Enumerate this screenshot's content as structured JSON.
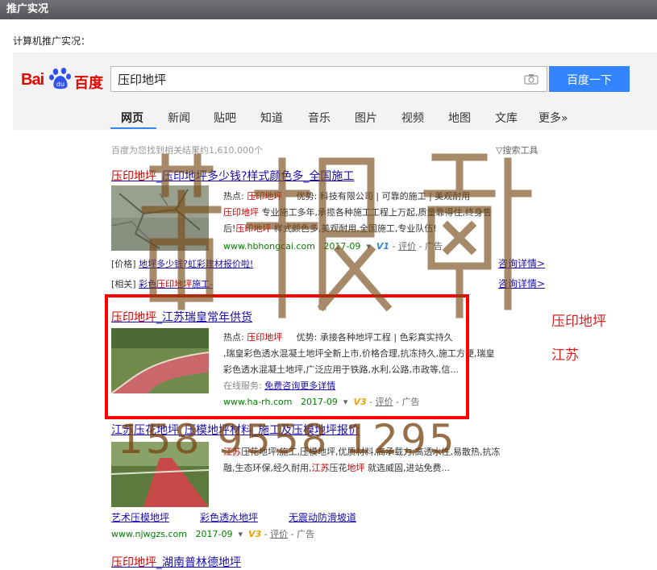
{
  "header": {
    "title": "推广实况"
  },
  "subtitle": "计算机推广实况：",
  "brand": {
    "part1": "Bai",
    "badge": "du",
    "part2": "百度"
  },
  "search": {
    "query": "压印地坪",
    "button": "百度一下"
  },
  "tabs": [
    "网页",
    "新闻",
    "贴吧",
    "知道",
    "音乐",
    "图片",
    "视频",
    "地图",
    "文库",
    "更多»"
  ],
  "stats": "百度为您找到相关结果约1,610,000个",
  "tools": "搜索工具",
  "results": [
    {
      "title_highlight": "压印地坪",
      "title_rest": "_压印地坪多少钱?样式颜色多_全国施工",
      "desc_line1_label": "热点: ",
      "desc_line1_kw": "压印地坪",
      "desc_line1_rest": "     优势: 科技有限公司 | 可靠的施工 | 美观耐用",
      "desc_line2_kw": "压印地坪",
      "desc_line2_rest": " 专业施工多年,承揽各种施工工程上万起,质量靠得住,终身售",
      "desc_line3_pre": "后!",
      "desc_line3_kw": "压印地坪",
      "desc_line3_rest": " 样式颜色多,美观耐用,全国施工,专业队伍!",
      "url": "www.hbhongcai.com",
      "date": "2017-09",
      "badge": "V1",
      "rate": "评价",
      "ad": "广告",
      "sub1_label": "[价格]",
      "sub1_link": "地坪多少钱?虹彩建材报价啦!",
      "sub1_right": "咨询详情>",
      "sub2_label": "[相关]",
      "sub2_link_pre": "彩色",
      "sub2_link_kw": "压印地坪",
      "sub2_link_rest": "施工-",
      "sub2_right": "咨询详情>"
    },
    {
      "title_highlight": "压印地坪",
      "title_rest": "_江苏瑞皇常年供货",
      "desc_line1_label": "热点: ",
      "desc_line1_kw": "压印地坪",
      "desc_line1_rest": "     优势: 承接各种地坪工程 | 色彩真实持久",
      "desc_line2": ",瑞皇彩色透水混凝土地坪全新上市,价格合理,抗冻持久,施工方便,瑞皇",
      "desc_line3": "彩色透水混凝土地坪,广泛应用于铁路,水利,公路,市政等,信...",
      "online_label": "在线服务: ",
      "online_link": "免费咨询更多详情",
      "url": "www.ha-rh.com",
      "date": "2017-09",
      "badge": "V3",
      "rate": "评价",
      "ad": "广告"
    },
    {
      "title": "江苏压花地坪_压模地坪材料_施工及压模地坪报价",
      "desc_line1_kw": "江苏",
      "desc_line1_rest": "压花地坪,施工,压模地坪,优质材料,高承载力,高透水性,易散热,抗冻",
      "desc_line2_pre": "融,生态环保,经久耐用,",
      "desc_line2_kw": "江苏",
      "desc_line2_mid": "压花",
      "desc_line2_kw2": "地坪",
      "desc_line2_rest": " 就选威固,进站免费...",
      "links": [
        "艺术压模地坪",
        "彩色透水地坪",
        "无震动防滑坡道"
      ],
      "url": "www.njwgzs.com",
      "date": "2017-09",
      "badge": "V3",
      "rate": "评价",
      "ad": "广告"
    },
    {
      "title_highlight": "压印地坪",
      "title_rest": "_湖南普林德地坪"
    }
  ],
  "annotations": {
    "note1": "压印地坪",
    "note2": "江苏"
  },
  "phone": "158 9558 1295",
  "colors": {
    "accent": "#3385ff",
    "highlight": "#ff0000",
    "link": "#1a0dab",
    "url": "#008000"
  }
}
